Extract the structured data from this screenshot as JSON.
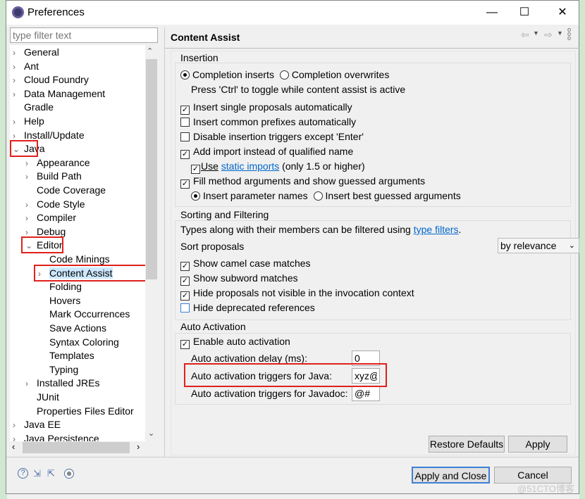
{
  "window": {
    "title": "Preferences",
    "minimize": "—",
    "maximize": "☐",
    "close": "✕"
  },
  "filter": {
    "placeholder": "type filter text"
  },
  "tree": [
    {
      "label": "General",
      "level": 0,
      "expand": true
    },
    {
      "label": "Ant",
      "level": 0,
      "expand": true
    },
    {
      "label": "Cloud Foundry",
      "level": 0,
      "expand": true
    },
    {
      "label": "Data Management",
      "level": 0,
      "expand": true
    },
    {
      "label": "Gradle",
      "level": 0,
      "expand": false
    },
    {
      "label": "Help",
      "level": 0,
      "expand": true
    },
    {
      "label": "Install/Update",
      "level": 0,
      "expand": true
    },
    {
      "label": "Java",
      "level": 0,
      "expand": "open"
    },
    {
      "label": "Appearance",
      "level": 1,
      "expand": true
    },
    {
      "label": "Build Path",
      "level": 1,
      "expand": true
    },
    {
      "label": "Code Coverage",
      "level": 1,
      "expand": false
    },
    {
      "label": "Code Style",
      "level": 1,
      "expand": true
    },
    {
      "label": "Compiler",
      "level": 1,
      "expand": true
    },
    {
      "label": "Debug",
      "level": 1,
      "expand": true
    },
    {
      "label": "Editor",
      "level": 1,
      "expand": "open"
    },
    {
      "label": "Code Minings",
      "level": 2,
      "expand": false
    },
    {
      "label": "Content Assist",
      "level": 2,
      "expand": true,
      "selected": true
    },
    {
      "label": "Folding",
      "level": 2,
      "expand": false
    },
    {
      "label": "Hovers",
      "level": 2,
      "expand": false
    },
    {
      "label": "Mark Occurrences",
      "level": 2,
      "expand": false
    },
    {
      "label": "Save Actions",
      "level": 2,
      "expand": false
    },
    {
      "label": "Syntax Coloring",
      "level": 2,
      "expand": false
    },
    {
      "label": "Templates",
      "level": 2,
      "expand": false
    },
    {
      "label": "Typing",
      "level": 2,
      "expand": false
    },
    {
      "label": "Installed JREs",
      "level": 1,
      "expand": true
    },
    {
      "label": "JUnit",
      "level": 1,
      "expand": false
    },
    {
      "label": "Properties Files Editor",
      "level": 1,
      "expand": false
    },
    {
      "label": "Java EE",
      "level": 0,
      "expand": true
    },
    {
      "label": "Java Persistence",
      "level": 0,
      "expand": true
    }
  ],
  "page": {
    "title": "Content Assist",
    "insertion": {
      "legend": "Insertion",
      "radio1": "Completion inserts",
      "radio2": "Completion overwrites",
      "hint": "Press 'Ctrl' to toggle while content assist is active",
      "c1": "Insert single proposals automatically",
      "c2": "Insert common prefixes automatically",
      "c3": "Disable insertion triggers except 'Enter'",
      "c4": "Add import instead of qualified name",
      "use": "Use",
      "static_imports": "static imports",
      "only": "(only 1.5 or higher)",
      "c5": "Fill method arguments and show guessed arguments",
      "r3": "Insert parameter names",
      "r4": "Insert best guessed arguments"
    },
    "sorting": {
      "legend": "Sorting and Filtering",
      "desc": "Types along with their members can be filtered using",
      "type_filters": "type filters",
      "period": ".",
      "sort_label": "Sort proposals",
      "sort_value": "by relevance",
      "c1": "Show camel case matches",
      "c2": "Show subword matches",
      "c3": "Hide proposals not visible in the invocation context",
      "c4": "Hide deprecated references"
    },
    "auto": {
      "legend": "Auto Activation",
      "enable": "Enable auto activation",
      "delay_label": "Auto activation delay (ms):",
      "delay": "0",
      "java_label": "Auto activation triggers for Java:",
      "java": "xyz@",
      "javadoc_label": "Auto activation triggers for Javadoc:",
      "javadoc": "@#"
    },
    "restore": "Restore Defaults",
    "apply": "Apply"
  },
  "footer": {
    "apply_close": "Apply and Close",
    "cancel": "Cancel",
    "watermark": "@51CTO博客"
  }
}
